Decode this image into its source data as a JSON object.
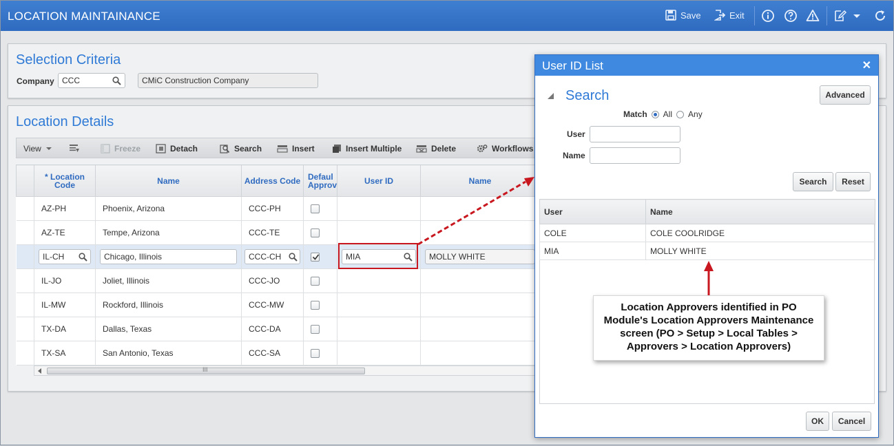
{
  "app": {
    "title": "LOCATION MAINTAINANCE",
    "toolbar": {
      "save_label": "Save",
      "exit_label": "Exit"
    }
  },
  "selection": {
    "title": "Selection Criteria",
    "company_label": "Company",
    "company_code": "CCC",
    "company_name": "CMiC Construction Company"
  },
  "details": {
    "title": "Location Details",
    "toolbar": {
      "view": "View",
      "freeze": "Freeze",
      "detach": "Detach",
      "search": "Search",
      "insert": "Insert",
      "insert_multiple": "Insert Multiple",
      "delete": "Delete",
      "workflows": "Workflows"
    },
    "columns": {
      "location_code": "* Location Code",
      "name": "Name",
      "address_code": "Address Code",
      "default_approver": "Defaul Approv",
      "user_id": "User ID",
      "user_name": "Name"
    },
    "rows": [
      {
        "code": "AZ-PH",
        "name": "Phoenix, Arizona",
        "address": "CCC-PH",
        "default": false,
        "user_id": "",
        "user_name": ""
      },
      {
        "code": "AZ-TE",
        "name": "Tempe, Arizona",
        "address": "CCC-TE",
        "default": false,
        "user_id": "",
        "user_name": ""
      },
      {
        "code": "IL-CH",
        "name": "Chicago, Illinois",
        "address": "CCC-CH",
        "default": true,
        "user_id": "MIA",
        "user_name": "MOLLY WHITE"
      },
      {
        "code": "IL-JO",
        "name": "Joliet, Illinois",
        "address": "CCC-JO",
        "default": false,
        "user_id": "",
        "user_name": ""
      },
      {
        "code": "IL-MW",
        "name": "Rockford, Illinois",
        "address": "CCC-MW",
        "default": false,
        "user_id": "",
        "user_name": ""
      },
      {
        "code": "TX-DA",
        "name": "Dallas, Texas",
        "address": "CCC-DA",
        "default": false,
        "user_id": "",
        "user_name": ""
      },
      {
        "code": "TX-SA",
        "name": "San Antonio, Texas",
        "address": "CCC-SA",
        "default": false,
        "user_id": "",
        "user_name": ""
      }
    ],
    "scroll_marker": "III"
  },
  "dialog": {
    "title": "User ID List",
    "close": "✕",
    "search_title": "Search",
    "advanced": "Advanced",
    "match_label": "Match",
    "match_all": "All",
    "match_any": "Any",
    "match_selected": "All",
    "user_label": "User",
    "name_label": "Name",
    "search_btn": "Search",
    "reset_btn": "Reset",
    "columns": {
      "user": "User",
      "name": "Name"
    },
    "rows": [
      {
        "user": "COLE",
        "name": "COLE COOLRIDGE"
      },
      {
        "user": "MIA",
        "name": "MOLLY WHITE"
      }
    ],
    "ok": "OK",
    "cancel": "Cancel"
  },
  "annotation": {
    "line1": "Location Approvers identified in PO",
    "line2": "Module's Location Approvers Maintenance",
    "line3": "screen (PO > Setup > Local Tables >",
    "line4": "Approvers > Location Approvers)",
    "color": "#c8171e"
  }
}
